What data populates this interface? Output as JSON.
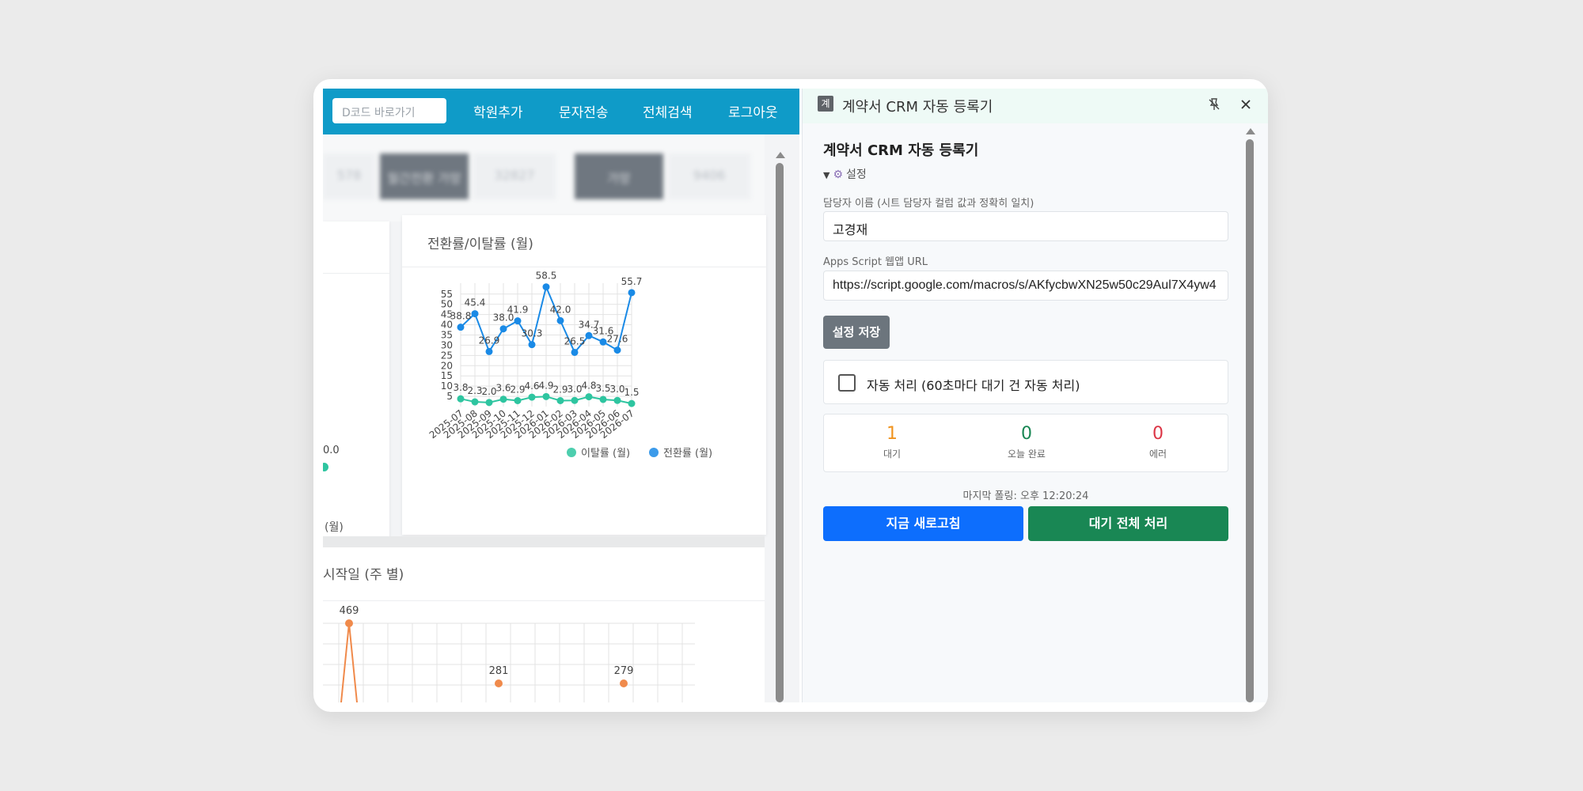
{
  "webpage": {
    "search_placeholder": "D코드 바로가기",
    "nav": [
      "학원추가",
      "문자전송",
      "전체검색",
      "로그아웃"
    ],
    "chips": [
      "578",
      "월간전환 가망",
      "32827",
      "가망",
      "9406"
    ],
    "left_card": {
      "value": "0.0",
      "footer": "(월)"
    },
    "bottom_card_title": "시작일 (주 별)",
    "colors": {
      "nav": "#0f9bc8",
      "churn": "#2ec5a0",
      "conversion": "#1a8ae6",
      "weekly": "#f08a4b"
    }
  },
  "panel": {
    "app_icon": "계",
    "title": "계약서 CRM 자동 등록기",
    "heading": "계약서 CRM 자동 등록기",
    "settings_label": "설정",
    "manager_label": "담당자 이름 (시트 담당자 컬럼 값과 정확히 일치)",
    "manager_value": "고경재",
    "url_label": "Apps Script 웹앱 URL",
    "url_value": "https://script.google.com/macros/s/AKfycbwXN25w50c29Aul7X4yw4",
    "save_label": "설정 저장",
    "auto_label": "자동 처리 (60초마다 대기 건 자동 처리)",
    "auto_checked": false,
    "stats": [
      {
        "value": "1",
        "label": "대기",
        "color": "#f0931e"
      },
      {
        "value": "0",
        "label": "오늘 완료",
        "color": "#198754"
      },
      {
        "value": "0",
        "label": "에러",
        "color": "#dc3545"
      }
    ],
    "last_poll": "마지막 폴링: 오후 12:20:24",
    "refresh_label": "지금 새로고침",
    "process_label": "대기 전체 처리"
  },
  "chart_data": [
    {
      "type": "line",
      "title": "전환률/이탈률 (월)",
      "categories": [
        "2025-07",
        "2025-08",
        "2025-09",
        "2025-10",
        "2025-11",
        "2025-12",
        "2026-01",
        "2026-02",
        "2026-03",
        "2026-04",
        "2026-05",
        "2026-06",
        "2026-07"
      ],
      "series": [
        {
          "name": "이탈률 (월)",
          "color": "#2ec5a0",
          "values": [
            3.8,
            2.3,
            2.0,
            3.6,
            2.9,
            4.6,
            4.9,
            2.9,
            3.0,
            4.8,
            3.5,
            3.0,
            1.5
          ]
        },
        {
          "name": "전환률 (월)",
          "color": "#1a8ae6",
          "values": [
            38.8,
            45.4,
            26.9,
            38.0,
            41.9,
            30.3,
            58.5,
            42.0,
            26.5,
            34.7,
            31.6,
            27.6,
            55.7
          ]
        }
      ],
      "yticks": [
        5,
        10,
        15,
        20,
        25,
        30,
        35,
        40,
        45,
        50,
        55
      ],
      "ylim": [
        0,
        58
      ],
      "legend": "bottom-right",
      "grid": true
    },
    {
      "type": "line",
      "title": "시작일 (주 별)",
      "series": [
        {
          "name": "",
          "color": "#f08a4b",
          "visible_labels": [
            469,
            281,
            279
          ]
        }
      ],
      "grid": true
    }
  ]
}
